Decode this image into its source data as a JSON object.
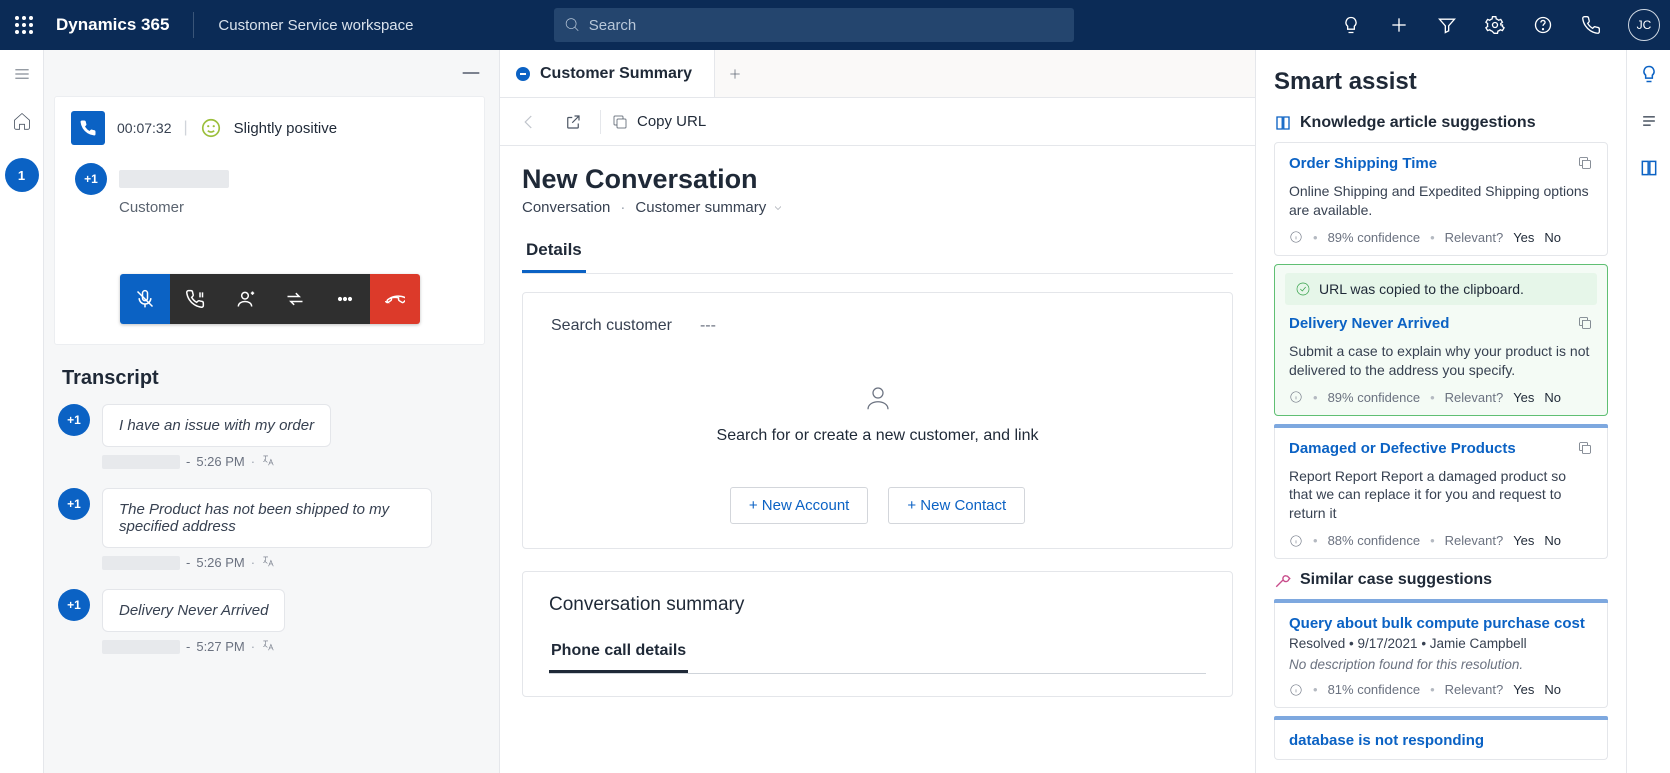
{
  "nav": {
    "brand": "Dynamics 365",
    "workspace": "Customer Service workspace",
    "search_placeholder": "Search",
    "avatar_initials": "JC"
  },
  "rail": {
    "session_badge": "1"
  },
  "conversation_panel": {
    "timer": "00:07:32",
    "sentiment": "Slightly positive",
    "customer_badge": "+1",
    "customer_role": "Customer",
    "transcript_header": "Transcript",
    "messages": [
      {
        "badge": "+1",
        "text": "I have an issue with my order",
        "time": "5:26 PM"
      },
      {
        "badge": "+1",
        "text": "The Product has not been shipped to my specified address",
        "time": "5:26 PM"
      },
      {
        "badge": "+1",
        "text": "Delivery Never Arrived",
        "time": "5:27 PM"
      }
    ]
  },
  "center": {
    "tab_label": "Customer Summary",
    "copy_url": "Copy URL",
    "page_title": "New Conversation",
    "crumb_conversation": "Conversation",
    "crumb_summary": "Customer summary",
    "details_tab": "Details",
    "search_customer_label": "Search customer",
    "search_customer_value": "---",
    "empty_text": "Search for or create a new customer, and link",
    "btn_new_account": "+  New Account",
    "btn_new_contact": "+  New Contact",
    "conversation_summary_title": "Conversation summary",
    "phone_call_tab": "Phone call details"
  },
  "smart_assist": {
    "header": "Smart assist",
    "section_knowledge": "Knowledge article suggestions",
    "section_cases": "Similar case suggestions",
    "confidence_label_89": "89% confidence",
    "confidence_label_88": "88% confidence",
    "confidence_label_81": "81% confidence",
    "relevant_label": "Relevant?",
    "yes": "Yes",
    "no": "No",
    "copied_banner": "URL was copied to the clipboard.",
    "knowledge": [
      {
        "title": "Order Shipping Time",
        "desc": "Online Shipping and Expedited Shipping options are available."
      },
      {
        "title": "Delivery Never Arrived",
        "desc": "Submit a case to explain why your product is not delivered to the address you specify."
      },
      {
        "title": "Damaged or Defective Products",
        "desc": "Report Report Report a damaged product so that we can replace it for you and request to return it"
      }
    ],
    "cases": [
      {
        "title": "Query about bulk compute purchase cost",
        "meta": "Resolved • 9/17/2021 • Jamie Campbell",
        "nores": "No description found for this resolution."
      },
      {
        "title": "database is not responding"
      }
    ]
  }
}
